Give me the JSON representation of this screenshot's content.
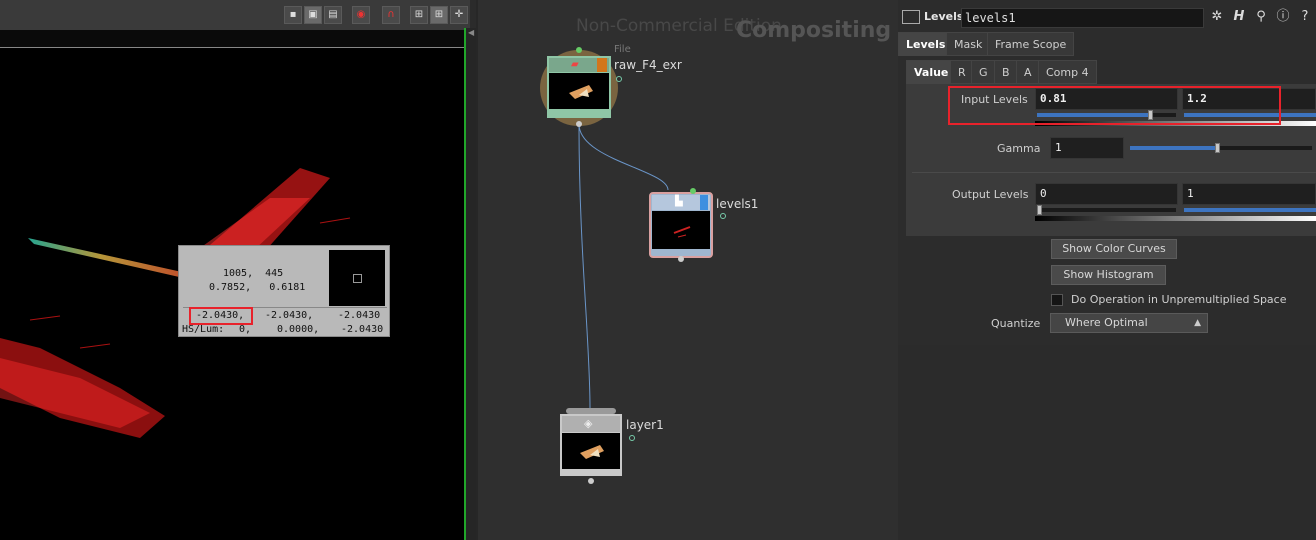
{
  "viewer": {
    "toolbar_icons": [
      "display-options-icon",
      "guide-icon",
      "overlay-icon",
      "snapshot-icon",
      "magnet-icon",
      "safe-area-icon",
      "grid-icon",
      "crosshair-icon"
    ],
    "pixel_info": {
      "coords": "1005,  445",
      "uv": "0.7852,   0.6181",
      "rgb_r": "-2.0430,",
      "rgb_g": "-2.0430,",
      "rgb_b": "-2.0430",
      "hslum_label": "HS/Lum:",
      "hslum_h": "0,",
      "hslum_s": "0.0000,",
      "hslum_l": "-2.0430"
    }
  },
  "network": {
    "watermark": "Non-Commercial Edition",
    "context_label": "Compositing",
    "nodes": [
      {
        "name": "raw_F4_exr",
        "type": "File"
      },
      {
        "name": "levels1",
        "type": ""
      },
      {
        "name": "layer1",
        "type": ""
      }
    ]
  },
  "params": {
    "node_type": "Levels",
    "node_name": "levels1",
    "header_icons": [
      "gear-icon",
      "help-h-icon",
      "search-icon",
      "info-icon",
      "question-icon"
    ],
    "tabs": [
      "Levels",
      "Mask",
      "Frame Scope"
    ],
    "subtabs": [
      "Value",
      "R",
      "G",
      "B",
      "A",
      "Comp 4"
    ],
    "input_levels": {
      "label": "Input Levels",
      "low": "0.81",
      "high": "1.2"
    },
    "gamma": {
      "label": "Gamma",
      "value": "1"
    },
    "output_levels": {
      "label": "Output Levels",
      "low": "0",
      "high": "1"
    },
    "slider_levels": {
      "input_low": 0.81,
      "gamma": 0.48
    },
    "buttons": {
      "color_curves": "Show Color Curves",
      "histogram": "Show Histogram"
    },
    "unpremultiplied_label": "Do Operation in Unpremultiplied Space",
    "quantize": {
      "label": "Quantize",
      "value": "Where Optimal"
    }
  },
  "colors": {
    "highlight": "#e8222b",
    "viewer_border": "#21a62a",
    "wire": "#6a95c8",
    "slider_fill": "#3d74c0"
  }
}
